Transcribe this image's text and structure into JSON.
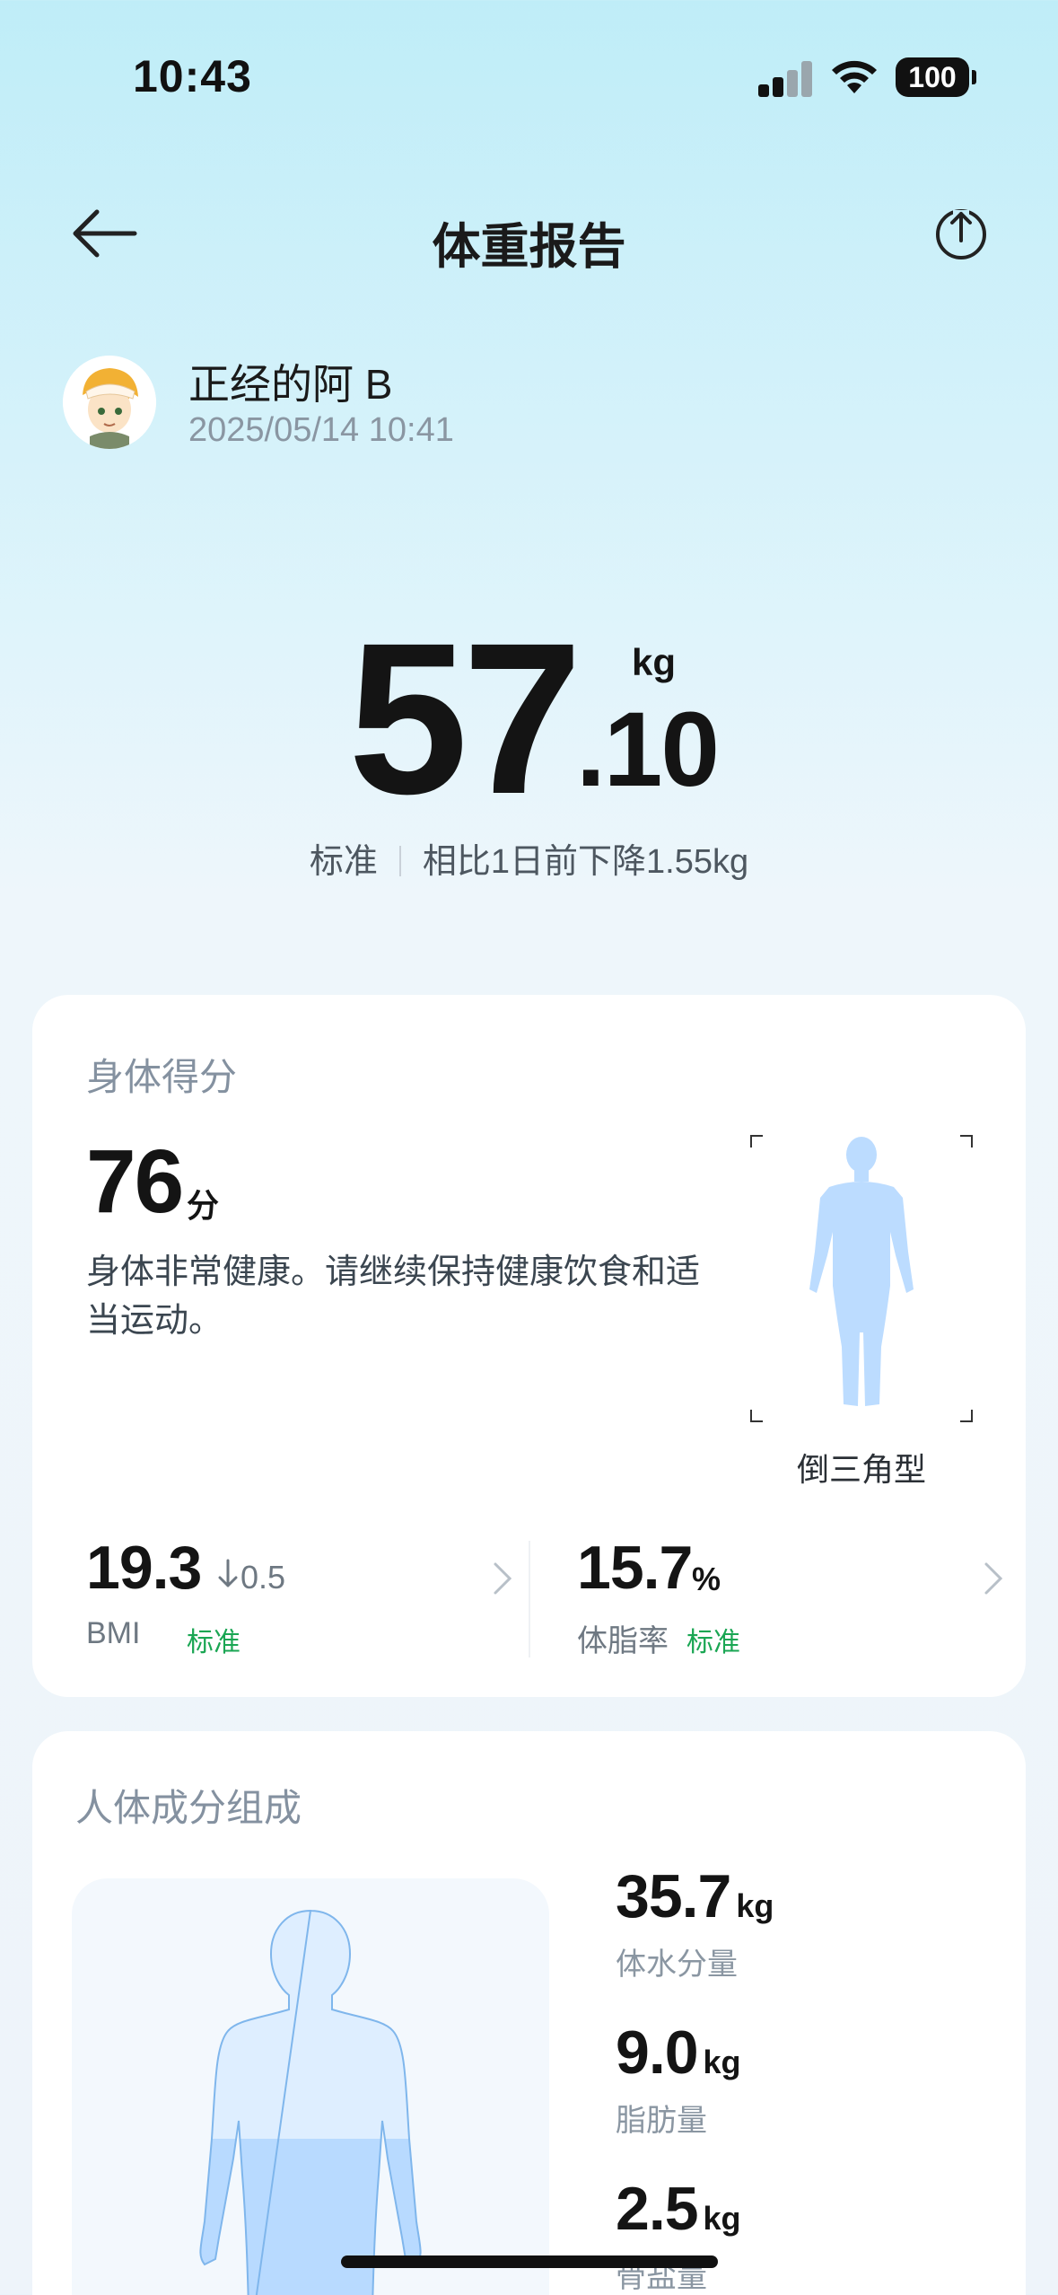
{
  "status_bar": {
    "time": "10:43",
    "battery": "100"
  },
  "header": {
    "title": "体重报告"
  },
  "user": {
    "name": "正经的阿 B",
    "datetime": "2025/05/14 10:41"
  },
  "weight": {
    "integer": "57",
    "decimal": ".10",
    "unit": "kg",
    "status": "标准",
    "change": "相比1日前下降1.55kg"
  },
  "body_score": {
    "title": "身体得分",
    "score": "76",
    "unit": "分",
    "description": "身体非常健康。请继续保持健康饮食和适当运动。",
    "body_type": "倒三角型",
    "bmi": {
      "value": "19.3",
      "delta": "0.5",
      "label": "BMI",
      "status": "标准"
    },
    "body_fat": {
      "value": "15.7",
      "unit": "%",
      "label": "体脂率",
      "status": "标准"
    }
  },
  "composition": {
    "title": "人体成分组成",
    "items": [
      {
        "value": "35.7",
        "unit": "kg",
        "label": "体水分量"
      },
      {
        "value": "9.0",
        "unit": "kg",
        "label": "脂肪量"
      },
      {
        "value": "2.5",
        "unit": "kg",
        "label": "骨盐量"
      }
    ]
  },
  "colors": {
    "accent_green": "#1aa653",
    "body_blue": "#bcdcff"
  }
}
